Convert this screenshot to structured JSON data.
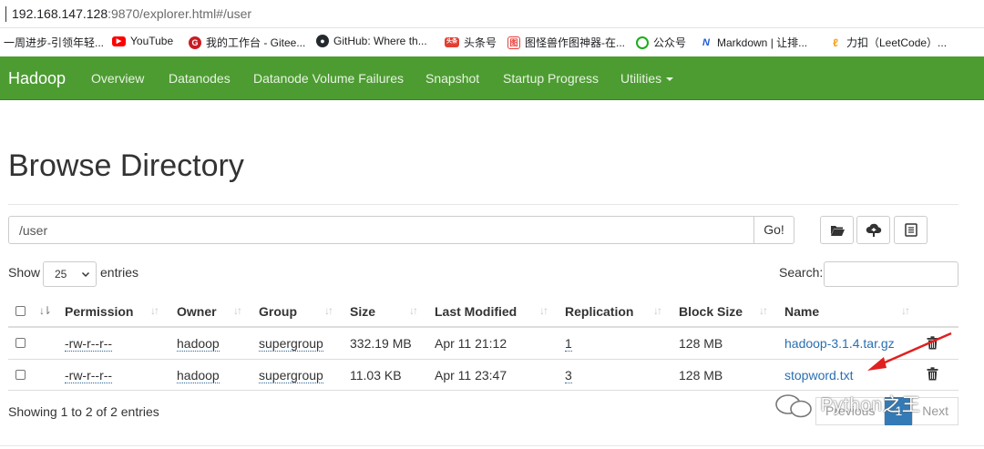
{
  "browser": {
    "url_host": "192.168.147.128",
    "url_rest": ":9870/explorer.html#/user",
    "bookmarks": [
      {
        "label": "一周进步-引领年轻...",
        "icon": "none",
        "color": ""
      },
      {
        "label": "YouTube",
        "icon": "youtube-icon",
        "color": "#ff0000"
      },
      {
        "label": "我的工作台 - Gitee...",
        "icon": "gitee-icon",
        "color": "#c71d23"
      },
      {
        "label": "GitHub: Where th...",
        "icon": "github-icon",
        "color": "#24292e"
      },
      {
        "label": "头条号",
        "icon": "toutiao-icon",
        "color": "#e33e33"
      },
      {
        "label": "图怪兽作图神器-在...",
        "icon": "tuguaishou-icon",
        "color": "#e8413c"
      },
      {
        "label": "公众号",
        "icon": "wechat-icon",
        "color": "#1aad19"
      },
      {
        "label": "Markdown | 让排...",
        "icon": "markdown-icon",
        "color": "#1e5bd6"
      },
      {
        "label": "力扣（LeetCode）...",
        "icon": "leetcode-icon",
        "color": "#f89f1b"
      }
    ]
  },
  "navbar": {
    "brand": "Hadoop",
    "links": [
      "Overview",
      "Datanodes",
      "Datanode Volume Failures",
      "Snapshot",
      "Startup Progress",
      "Utilities"
    ],
    "bg_color": "#4d9c32"
  },
  "page": {
    "title": "Browse Directory",
    "path_value": "/user",
    "go_label": "Go!",
    "show_label": "Show",
    "page_size": "25",
    "entries_label": "entries",
    "search_label": "Search:",
    "info": "Showing 1 to 2 of 2 entries",
    "pager": {
      "previous": "Previous",
      "current": "1",
      "next": "Next"
    },
    "watermark": "Python之王"
  },
  "table": {
    "headers": [
      "Permission",
      "Owner",
      "Group",
      "Size",
      "Last Modified",
      "Replication",
      "Block Size",
      "Name"
    ],
    "rows": [
      {
        "permission": "-rw-r--r--",
        "owner": "hadoop",
        "group": "supergroup",
        "size": "332.19 MB",
        "modified": "Apr 11 21:12",
        "replication": "1",
        "block_size": "128 MB",
        "name": "hadoop-3.1.4.tar.gz"
      },
      {
        "permission": "-rw-r--r--",
        "owner": "hadoop",
        "group": "supergroup",
        "size": "11.03 KB",
        "modified": "Apr 11 23:47",
        "replication": "3",
        "block_size": "128 MB",
        "name": "stopword.txt"
      }
    ]
  }
}
